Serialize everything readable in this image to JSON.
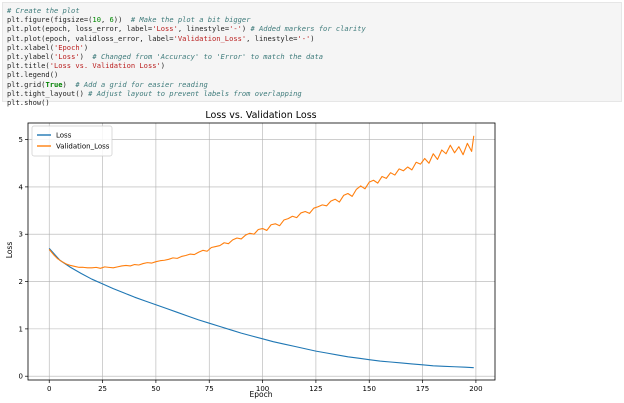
{
  "code_cell": {
    "lines": [
      [
        {
          "t": "# Create the plot",
          "k": "comment"
        }
      ],
      [
        {
          "t": "plt.figure(figsize=(",
          "k": "default"
        },
        {
          "t": "10",
          "k": "number"
        },
        {
          "t": ", ",
          "k": "default"
        },
        {
          "t": "6",
          "k": "number"
        },
        {
          "t": "))  ",
          "k": "default"
        },
        {
          "t": "# Make the plot a bit bigger",
          "k": "comment"
        }
      ],
      [
        {
          "t": "plt.plot(epoch, loss_error, label=",
          "k": "default"
        },
        {
          "t": "'Loss'",
          "k": "string"
        },
        {
          "t": ", linestyle=",
          "k": "default"
        },
        {
          "t": "'-'",
          "k": "string"
        },
        {
          "t": ") ",
          "k": "default"
        },
        {
          "t": "# Added markers for clarity",
          "k": "comment"
        }
      ],
      [
        {
          "t": "plt.plot(epoch, validloss_error, label=",
          "k": "default"
        },
        {
          "t": "'Validation_Loss'",
          "k": "string"
        },
        {
          "t": ", linestyle=",
          "k": "default"
        },
        {
          "t": "'-'",
          "k": "string"
        },
        {
          "t": ")",
          "k": "default"
        }
      ],
      [
        {
          "t": "plt.xlabel(",
          "k": "default"
        },
        {
          "t": "'Epoch'",
          "k": "string"
        },
        {
          "t": ")",
          "k": "default"
        }
      ],
      [
        {
          "t": "plt.ylabel(",
          "k": "default"
        },
        {
          "t": "'Loss'",
          "k": "string"
        },
        {
          "t": ")  ",
          "k": "default"
        },
        {
          "t": "# Changed from 'Accuracy' to 'Error' to match the data",
          "k": "comment"
        }
      ],
      [
        {
          "t": "plt.title(",
          "k": "default"
        },
        {
          "t": "'Loss vs. Validation Loss'",
          "k": "string"
        },
        {
          "t": ")",
          "k": "default"
        }
      ],
      [
        {
          "t": "plt.legend()",
          "k": "default"
        }
      ],
      [
        {
          "t": "plt.grid(",
          "k": "default"
        },
        {
          "t": "True",
          "k": "kw"
        },
        {
          "t": ")  ",
          "k": "default"
        },
        {
          "t": "# Add a grid for easier reading",
          "k": "comment"
        }
      ],
      [
        {
          "t": "plt.tight_layout() ",
          "k": "default"
        },
        {
          "t": "# Adjust layout to prevent labels from overlapping",
          "k": "comment"
        }
      ],
      [
        {
          "t": "plt.show()",
          "k": "default"
        }
      ]
    ]
  },
  "chart_data": {
    "type": "line",
    "title": "Loss vs. Validation Loss",
    "xlabel": "Epoch",
    "ylabel": "Loss",
    "xlim": [
      -9.95,
      208.95
    ],
    "ylim": [
      -0.08,
      5.35
    ],
    "xticks": [
      0,
      25,
      50,
      75,
      100,
      125,
      150,
      175,
      200
    ],
    "yticks": [
      0,
      1,
      2,
      3,
      4,
      5
    ],
    "grid": true,
    "legend_position": "top-left",
    "series": [
      {
        "name": "Loss",
        "color": "#1f77b4",
        "x": [
          0,
          5,
          10,
          15,
          20,
          25,
          30,
          35,
          40,
          45,
          50,
          55,
          60,
          65,
          70,
          75,
          80,
          85,
          90,
          95,
          100,
          105,
          110,
          115,
          120,
          125,
          130,
          135,
          140,
          145,
          150,
          155,
          160,
          165,
          170,
          175,
          180,
          185,
          190,
          195,
          199
        ],
        "y": [
          2.7,
          2.45,
          2.3,
          2.17,
          2.05,
          1.95,
          1.85,
          1.76,
          1.67,
          1.59,
          1.51,
          1.43,
          1.35,
          1.27,
          1.19,
          1.12,
          1.05,
          0.98,
          0.91,
          0.85,
          0.79,
          0.73,
          0.68,
          0.63,
          0.58,
          0.53,
          0.49,
          0.45,
          0.41,
          0.38,
          0.35,
          0.32,
          0.3,
          0.28,
          0.26,
          0.24,
          0.22,
          0.21,
          0.2,
          0.19,
          0.18
        ]
      },
      {
        "name": "Validation_Loss",
        "color": "#ff7f0e",
        "x": [
          0,
          2,
          4,
          6,
          8,
          10,
          12,
          14,
          16,
          18,
          20,
          22,
          24,
          26,
          28,
          30,
          32,
          34,
          36,
          38,
          40,
          42,
          44,
          46,
          48,
          50,
          52,
          54,
          56,
          58,
          60,
          62,
          64,
          66,
          68,
          70,
          72,
          74,
          76,
          78,
          80,
          82,
          84,
          86,
          88,
          90,
          92,
          94,
          96,
          98,
          100,
          102,
          104,
          106,
          108,
          110,
          112,
          114,
          116,
          118,
          120,
          122,
          124,
          126,
          128,
          130,
          132,
          134,
          136,
          138,
          140,
          142,
          144,
          146,
          148,
          150,
          152,
          154,
          156,
          158,
          160,
          162,
          164,
          166,
          168,
          170,
          172,
          174,
          176,
          178,
          180,
          182,
          184,
          186,
          188,
          190,
          192,
          194,
          196,
          198,
          199
        ],
        "y": [
          2.68,
          2.57,
          2.48,
          2.42,
          2.37,
          2.34,
          2.32,
          2.3,
          2.3,
          2.29,
          2.29,
          2.3,
          2.28,
          2.31,
          2.3,
          2.29,
          2.31,
          2.33,
          2.34,
          2.33,
          2.36,
          2.35,
          2.38,
          2.4,
          2.39,
          2.42,
          2.44,
          2.45,
          2.47,
          2.5,
          2.49,
          2.53,
          2.55,
          2.58,
          2.57,
          2.62,
          2.66,
          2.64,
          2.72,
          2.74,
          2.76,
          2.82,
          2.8,
          2.88,
          2.92,
          2.9,
          2.98,
          3.02,
          3.0,
          3.1,
          3.12,
          3.08,
          3.2,
          3.22,
          3.18,
          3.3,
          3.33,
          3.38,
          3.35,
          3.45,
          3.48,
          3.44,
          3.55,
          3.58,
          3.62,
          3.6,
          3.7,
          3.74,
          3.68,
          3.82,
          3.86,
          3.8,
          3.95,
          4.02,
          3.96,
          4.1,
          4.14,
          4.08,
          4.22,
          4.18,
          4.3,
          4.25,
          4.38,
          4.34,
          4.42,
          4.36,
          4.52,
          4.48,
          4.6,
          4.5,
          4.7,
          4.58,
          4.78,
          4.7,
          4.88,
          4.72,
          4.85,
          4.68,
          4.92,
          4.75,
          5.08
        ]
      }
    ]
  }
}
